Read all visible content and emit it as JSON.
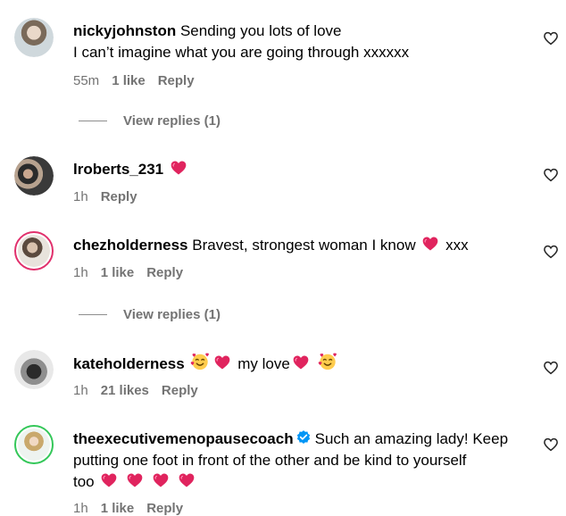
{
  "comments": [
    {
      "username": "nickyjohnston",
      "text": "Sending you lots of love",
      "text2": "I can’t imagine what you are going through xxxxxx",
      "time": "55m",
      "likes": "1 like",
      "reply": "Reply",
      "view_replies": "View replies (1)"
    },
    {
      "username": "lroberts_231",
      "time": "1h",
      "reply": "Reply"
    },
    {
      "username": "chezholderness",
      "text": "Bravest, strongest woman I know",
      "text_after": "xxx",
      "time": "1h",
      "likes": "1 like",
      "reply": "Reply",
      "view_replies": "View replies (1)"
    },
    {
      "username": "kateholderness",
      "text": "my love",
      "time": "1h",
      "likes": "21 likes",
      "reply": "Reply"
    },
    {
      "username": "theexecutivemenopausecoach",
      "text": "Such an amazing lady! Keep",
      "text2": "putting one foot in front of the other and be kind to yourself",
      "text3": "too",
      "time": "1h",
      "likes": "1 like",
      "reply": "Reply"
    }
  ],
  "colors": {
    "heart_emoji": "#e0245e",
    "ring": "#e1306c",
    "verified": "#0095f6",
    "muted": "#737373"
  },
  "icons": [
    "avatar",
    "heart-outline-icon",
    "red-heart-emoji",
    "smiling-face-with-hearts-emoji",
    "verified-badge-icon"
  ]
}
